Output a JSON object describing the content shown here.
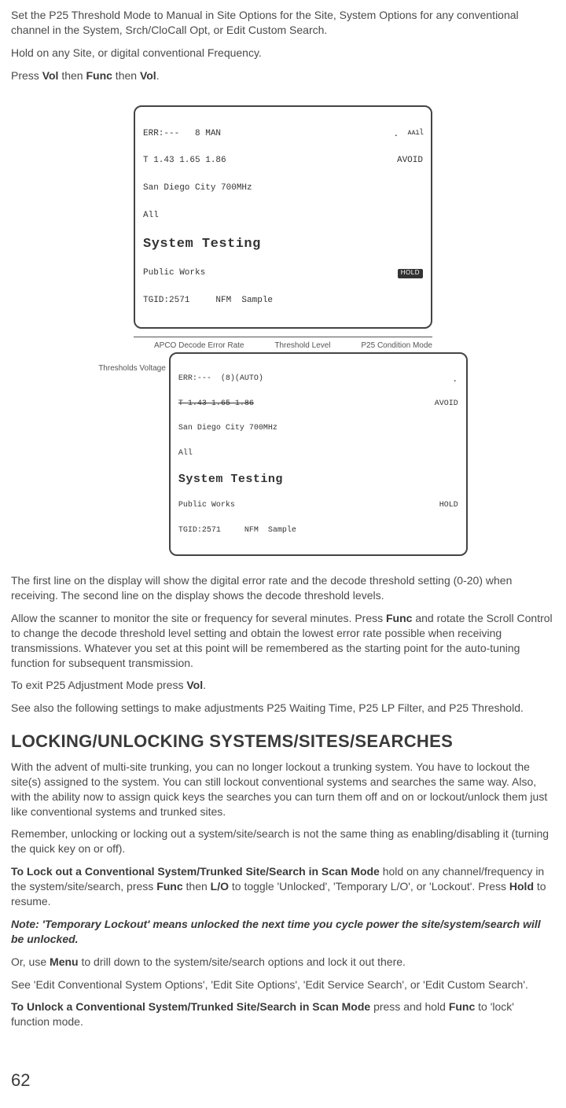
{
  "p1a": "Set the P25 Threshold Mode to Manual in Site Options for the Site, System Options for any conventional channel in the System, Srch/CloCall Opt, or Edit Custom Search.",
  "p1b": "Hold on any Site, or digital conventional Frequency.",
  "p1c_pre": "Press ",
  "p1c_vol1": "Vol",
  "p1c_mid1": " then ",
  "p1c_func": "Func",
  "p1c_mid2": " then ",
  "p1c_vol2": "Vol",
  "p1c_end": ".",
  "lcd1": {
    "l1a": "ERR:---   8 MAN",
    "l1b_wifi": "⡀  ᴀᴀıl",
    "l2a": "T 1.43 1.65 1.86",
    "l2b": "AVOID",
    "l3": "San Diego City 700MHz",
    "l4": "All",
    "big": "System Testing",
    "l5a": "Public Works",
    "hold": "HOLD",
    "l6": "TGID:2571     NFM  Sample"
  },
  "annot": {
    "a1": "APCO Decode Error Rate",
    "a2": "Threshold Level",
    "a3": "P25 Condition Mode",
    "a4": "Thresholds Voltage"
  },
  "lcd2": {
    "l1a": "ERR:---  (8)(AUTO)",
    "l1b_wifi": "⡀",
    "l2a": "T 1.43 1.65 1.86",
    "l2b": "AVOID",
    "l3": "San Diego City 700MHz",
    "l4": "All",
    "big": "System Testing",
    "l5a": "Public Works",
    "hold": "HOLD",
    "l6": "TGID:2571     NFM  Sample"
  },
  "p2": "The first line on the display will show the digital error rate and the decode threshold setting (0-20) when receiving. The second line on the display shows the decode threshold levels.",
  "p3a": "Allow the scanner to monitor the site or frequency for several minutes. Press ",
  "p3b": "Func",
  "p3c": " and rotate the Scroll Control to change the decode threshold level setting and obtain the lowest error rate possible when receiving transmissions. Whatever you set at this point will be remembered as the starting point for the auto-tuning function for subsequent transmission.",
  "p4a": "To exit P25 Adjustment Mode press ",
  "p4b": "Vol",
  "p4c": ".",
  "p5": "See also the following settings to make adjustments P25 Waiting Time, P25 LP Filter, and P25 Threshold.",
  "h2": "LOCKING/UNLOCKING SYSTEMS/SITES/SEARCHES",
  "p6": "With the advent of multi-site trunking, you can no longer lockout a trunking system. You have to lockout the site(s) assigned to the system. You can still lockout conventional systems and searches the same way. Also, with the ability now to assign quick keys the searches you can turn them off and on or lockout/unlock them just like conventional systems and trunked sites.",
  "p7": "Remember, unlocking or locking out a system/site/search is not the same thing as enabling/disabling it (turning the quick key on or off).",
  "p8a": "To Lock out a Conventional System/Trunked Site/Search in Scan Mode",
  "p8b": " hold on any channel/frequency in the system/site/search, press ",
  "p8c": "Func",
  "p8d": " then ",
  "p8e": "L/O",
  "p8f": " to toggle 'Unlocked', 'Temporary L/O', or 'Lockout'. Press ",
  "p8g": "Hold",
  "p8h": " to resume.",
  "p9": "Note: 'Temporary Lockout' means unlocked the next time you cycle power the site/system/search will be unlocked.",
  "p10a": "Or, use ",
  "p10b": "Menu",
  "p10c": " to drill down to the system/site/search options and lock it out there.",
  "p11": "See 'Edit Conventional System Options', 'Edit Site Options', 'Edit Service Search', or 'Edit Custom Search'.",
  "p12a": "To Unlock a Conventional System/Trunked Site/Search in Scan Mode",
  "p12b": " press and hold ",
  "p12c": "Func",
  "p12d": " to 'lock' function mode.",
  "page": "62"
}
